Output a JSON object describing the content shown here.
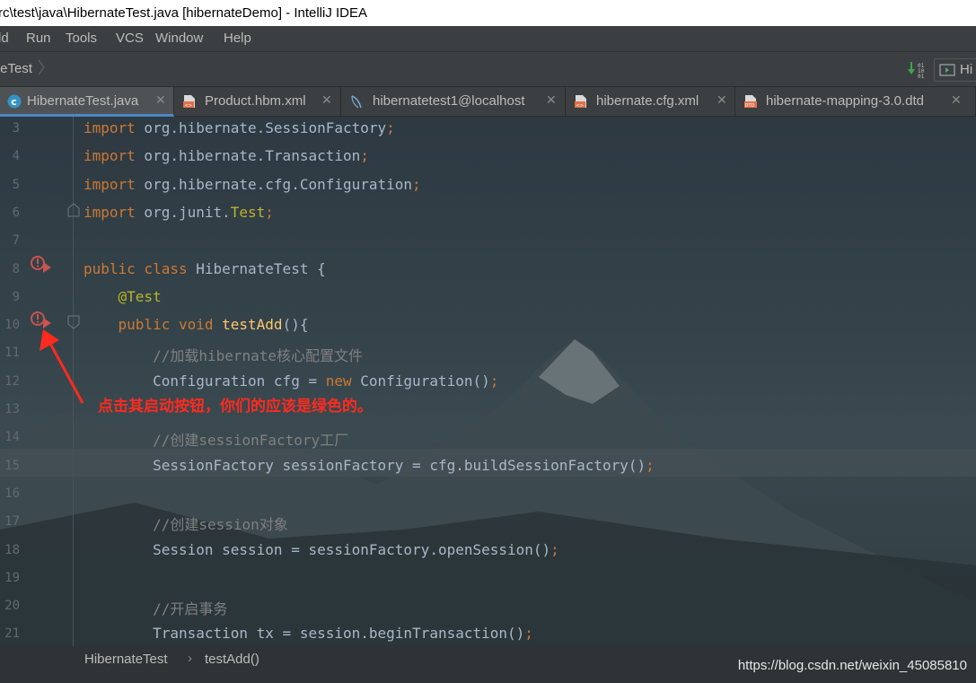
{
  "window": {
    "title": "rc\\test\\java\\HibernateTest.java [hibernateDemo] - IntelliJ IDEA"
  },
  "menu": [
    {
      "label": "ld"
    },
    {
      "label": "Run"
    },
    {
      "label": "Tools"
    },
    {
      "label": "VCS"
    },
    {
      "label": "Window"
    },
    {
      "label": "Help"
    }
  ],
  "navbar": {
    "crumb": "teTest",
    "right_button": "Hi"
  },
  "tabs": [
    {
      "label": "HibernateTest.java",
      "icon": "java-class-icon",
      "active": true
    },
    {
      "label": "Product.hbm.xml",
      "icon": "xml-file-icon",
      "active": false
    },
    {
      "label": "hibernatetest1@localhost",
      "icon": "database-icon",
      "active": false
    },
    {
      "label": "hibernate.cfg.xml",
      "icon": "xml-file-icon",
      "active": false
    },
    {
      "label": "hibernate-mapping-3.0.dtd",
      "icon": "dtd-file-icon",
      "active": false
    }
  ],
  "code": {
    "line_numbers": [
      "3",
      "4",
      "5",
      "6",
      "7",
      "8",
      "9",
      "10",
      "11",
      "12",
      "13",
      "14",
      "15",
      "16",
      "17",
      "18",
      "19",
      "20",
      "21"
    ],
    "lines": [
      {
        "parts": [
          {
            "t": "import",
            "c": "kw"
          },
          {
            "t": " org.hibernate.SessionFactory",
            "c": ""
          },
          {
            "t": ";",
            "c": "kw"
          }
        ]
      },
      {
        "parts": [
          {
            "t": "import",
            "c": "kw"
          },
          {
            "t": " org.hibernate.Transaction",
            "c": ""
          },
          {
            "t": ";",
            "c": "kw"
          }
        ]
      },
      {
        "parts": [
          {
            "t": "import",
            "c": "kw"
          },
          {
            "t": " org.hibernate.cfg.Configuration",
            "c": ""
          },
          {
            "t": ";",
            "c": "kw"
          }
        ]
      },
      {
        "parts": [
          {
            "t": "import",
            "c": "kw"
          },
          {
            "t": " org.junit.",
            "c": ""
          },
          {
            "t": "Test",
            "c": "ann"
          },
          {
            "t": ";",
            "c": "kw"
          }
        ]
      },
      {
        "parts": []
      },
      {
        "parts": [
          {
            "t": "public class",
            "c": "kw"
          },
          {
            "t": " HibernateTest {",
            "c": ""
          }
        ]
      },
      {
        "parts": [
          {
            "t": "    @Test",
            "c": "ann"
          }
        ]
      },
      {
        "parts": [
          {
            "t": "    public void ",
            "c": "kw"
          },
          {
            "t": "testAdd",
            "c": "fn"
          },
          {
            "t": "(){",
            "c": ""
          }
        ]
      },
      {
        "parts": [
          {
            "t": "        //加载hibernate核心配置文件",
            "c": "cm"
          }
        ]
      },
      {
        "parts": [
          {
            "t": "        Configuration cfg = ",
            "c": ""
          },
          {
            "t": "new",
            "c": "kw"
          },
          {
            "t": " Configuration()",
            "c": ""
          },
          {
            "t": ";",
            "c": "kw"
          }
        ]
      },
      {
        "parts": []
      },
      {
        "parts": [
          {
            "t": "        //创建sessionFactory工厂",
            "c": "cm"
          }
        ]
      },
      {
        "parts": [
          {
            "t": "        SessionFactory sessionFactory = cfg.buildSessionFactory()",
            "c": ""
          },
          {
            "t": ";",
            "c": "kw"
          }
        ]
      },
      {
        "parts": []
      },
      {
        "parts": [
          {
            "t": "        //创建session对象",
            "c": "cm"
          }
        ]
      },
      {
        "parts": [
          {
            "t": "        Session session = sessionFactory.openSession()",
            "c": ""
          },
          {
            "t": ";",
            "c": "kw"
          }
        ]
      },
      {
        "parts": []
      },
      {
        "parts": [
          {
            "t": "        //开启事务",
            "c": "cm"
          }
        ]
      },
      {
        "parts": [
          {
            "t": "        Transaction tx = session.beginTransaction()",
            "c": ""
          },
          {
            "t": ";",
            "c": "kw"
          }
        ]
      }
    ]
  },
  "annotation": "点击其启动按钮，你们的应该是绿色的。",
  "breadcrumb": {
    "class": "HibernateTest",
    "method": "testAdd()",
    "separator": "›"
  },
  "watermark": "https://blog.csdn.net/weixin_45085810",
  "colors": {
    "keyword": "#cc7832",
    "annotation": "#bbb529",
    "method": "#ffc66d",
    "comment": "#808080",
    "text": "#a9b7c6",
    "note": "#ff2a1f"
  }
}
